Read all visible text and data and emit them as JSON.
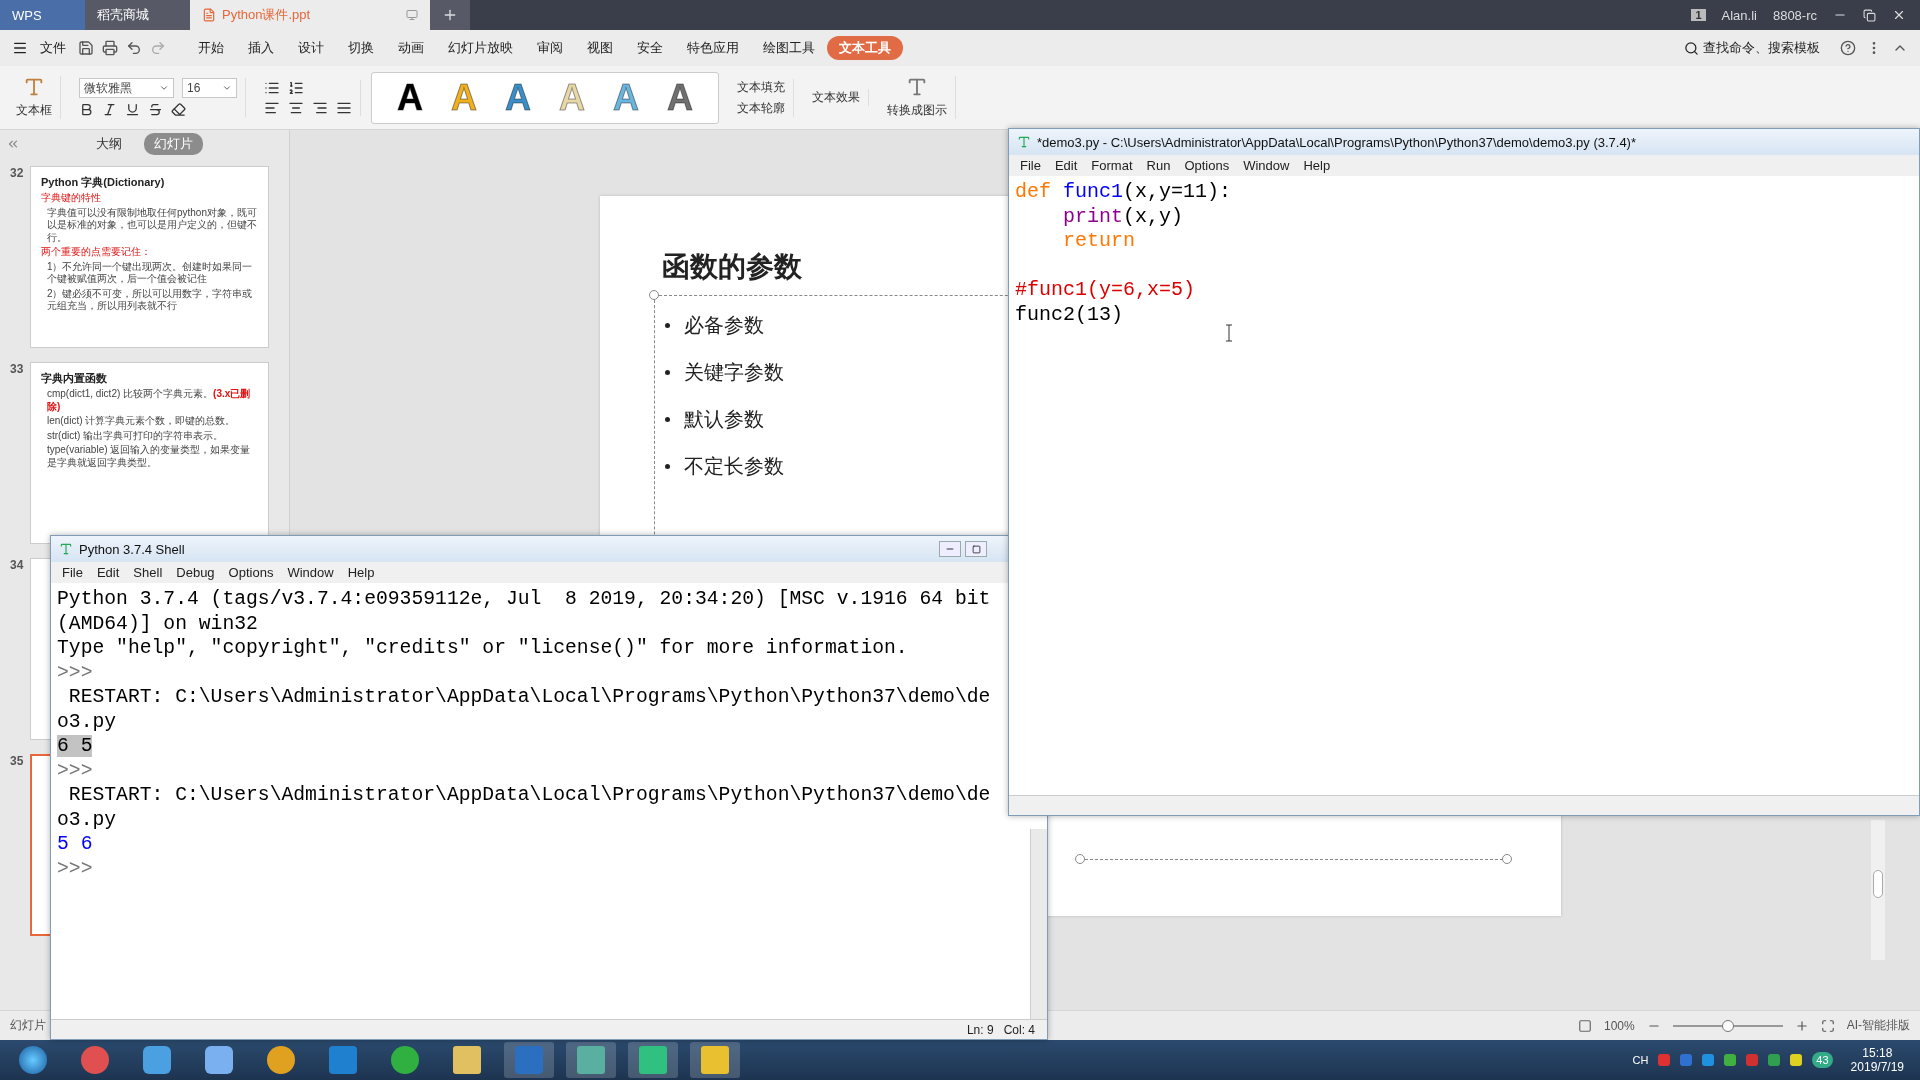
{
  "tabs": [
    {
      "label": "WPS",
      "kind": "home",
      "selected": false
    },
    {
      "label": "稻壳商城",
      "kind": "store",
      "selected": false
    },
    {
      "label": "Python课件.ppt",
      "kind": "doc",
      "selected": true
    }
  ],
  "titlebar_right": {
    "badge": "1",
    "user": "Alan.li",
    "label": "8808-rc"
  },
  "menu": [
    {
      "label": "开始",
      "selected": false
    },
    {
      "label": "插入",
      "selected": false
    },
    {
      "label": "设计",
      "selected": false
    },
    {
      "label": "切换",
      "selected": false
    },
    {
      "label": "动画",
      "selected": false
    },
    {
      "label": "幻灯片放映",
      "selected": false
    },
    {
      "label": "审阅",
      "selected": false
    },
    {
      "label": "视图",
      "selected": false
    },
    {
      "label": "安全",
      "selected": false
    },
    {
      "label": "特色应用",
      "selected": false
    },
    {
      "label": "绘图工具",
      "selected": false
    },
    {
      "label": "文本工具",
      "selected": true
    }
  ],
  "file_menu": "文件",
  "search": "查找命令、搜索模板",
  "ribbon": {
    "textbox": "文本框",
    "font": "微软雅黑",
    "size": "16",
    "text_fill": "文本填充",
    "text_outline": "文本轮廓",
    "text_effect": "文本效果",
    "convert": "转换成图示"
  },
  "styles": [
    {
      "label": "A",
      "color": "#000000"
    },
    {
      "label": "A",
      "color": "#f0b020"
    },
    {
      "label": "A",
      "color": "#3b8fc8"
    },
    {
      "label": "A",
      "color": "#e8d8a8"
    },
    {
      "label": "A",
      "color": "#6ab4de"
    },
    {
      "label": "A",
      "color": "#707070"
    }
  ],
  "panel": {
    "tabs": [
      {
        "label": "大纲",
        "selected": false
      },
      {
        "label": "幻灯片",
        "selected": true
      }
    ],
    "slides": [
      {
        "number": "32",
        "selected": false,
        "title": "Python 字典(Dictionary)",
        "lines": [
          {
            "text": "字典键的特性",
            "kind": "heading"
          },
          {
            "text": "字典值可以没有限制地取任何python对象，既可以是标准的对象，也可以是用户定义的，但键不行。",
            "kind": "body"
          },
          {
            "text": "两个重要的点需要记住：",
            "kind": "heading"
          },
          {
            "text": "1）不允许同一个键出现两次。创建时如果同一个键被赋值两次，后一个值会被记住",
            "kind": "body"
          },
          {
            "text": "2）键必须不可变，所以可以用数字，字符串或元组充当，所以用列表就不行",
            "kind": "body"
          }
        ]
      },
      {
        "number": "33",
        "selected": false,
        "title": "字典内置函数",
        "lines": [
          {
            "text": "cmp(dict1, dict2) 比较两个字典元素。**(3.x已删除)**",
            "kind": "body"
          },
          {
            "text": "len(dict) 计算字典元素个数，即键的总数。",
            "kind": "body"
          },
          {
            "text": "str(dict) 输出字典可打印的字符串表示。",
            "kind": "body"
          },
          {
            "text": "type(variable) 返回输入的变量类型，如果变量是字典就返回字典类型。",
            "kind": "body"
          }
        ]
      },
      {
        "number": "34",
        "selected": false
      },
      {
        "number": "35",
        "selected": true
      }
    ]
  },
  "slide": {
    "title": "函数的参数",
    "bullets": [
      "必备参数",
      "关键字参数",
      "默认参数",
      "不定长参数"
    ]
  },
  "editor": {
    "title": "*demo3.py - C:\\Users\\Administrator\\AppData\\Local\\Programs\\Python\\Python37\\demo\\demo3.py (3.7.4)*",
    "menu": [
      "File",
      "Edit",
      "Format",
      "Run",
      "Options",
      "Window",
      "Help"
    ],
    "lines": [
      {
        "blank_before": false,
        "tokens": [
          {
            "text": "def ",
            "kind": "keyword"
          },
          {
            "text": "func1",
            "kind": "definition"
          },
          {
            "text": "(x,y=11):",
            "kind": "plain"
          }
        ]
      },
      {
        "blank_before": false,
        "tokens": [
          {
            "text": "    print",
            "kind": "builtin"
          },
          {
            "text": "(x,y)",
            "kind": "plain"
          }
        ]
      },
      {
        "blank_before": false,
        "tokens": [
          {
            "text": "    return",
            "kind": "keyword"
          }
        ]
      },
      {
        "blank_before": true,
        "tokens": [
          {
            "text": "#func1(y=6,x=5)",
            "kind": "comment"
          }
        ]
      },
      {
        "blank_before": false,
        "tokens": [
          {
            "text": "func2(13)",
            "kind": "plain"
          }
        ]
      }
    ]
  },
  "shell": {
    "title": "Python 3.7.4 Shell",
    "menu": [
      "File",
      "Edit",
      "Shell",
      "Debug",
      "Options",
      "Window",
      "Help"
    ],
    "lines": [
      {
        "text": "Python 3.7.4 (tags/v3.7.4:e09359112e, Jul  8 2019, 20:34:20) [MSC v.1916 64 bit",
        "kind": "output"
      },
      {
        "text": "(AMD64)] on win32",
        "kind": "output"
      },
      {
        "text": "Type \"help\", \"copyright\", \"credits\" or \"license()\" for more information.",
        "kind": "output"
      },
      {
        "text": ">>>",
        "kind": "prompt"
      },
      {
        "text": " RESTART: C:\\Users\\Administrator\\AppData\\Local\\Programs\\Python\\Python37\\demo\\de",
        "kind": "output"
      },
      {
        "text": "o3.py",
        "kind": "output"
      },
      {
        "text": "6 5",
        "kind": "selected"
      },
      {
        "text": ">>>",
        "kind": "prompt"
      },
      {
        "text": " RESTART: C:\\Users\\Administrator\\AppData\\Local\\Programs\\Python\\Python37\\demo\\de",
        "kind": "output"
      },
      {
        "text": "o3.py",
        "kind": "output"
      },
      {
        "text": "5 6",
        "kind": "stdout"
      },
      {
        "text": ">>>",
        "kind": "prompt"
      }
    ],
    "status": [
      "Ln: 9",
      "Col: 4"
    ]
  },
  "status_bar": {
    "left": "幻灯片",
    "zoom": "100%",
    "zoom_slider": {
      "level": 0.5
    },
    "ai": "AI-智能排版"
  },
  "taskbar": {
    "lang": "CH",
    "badge": "43",
    "time": "15:18",
    "date": "2019/7/19"
  }
}
